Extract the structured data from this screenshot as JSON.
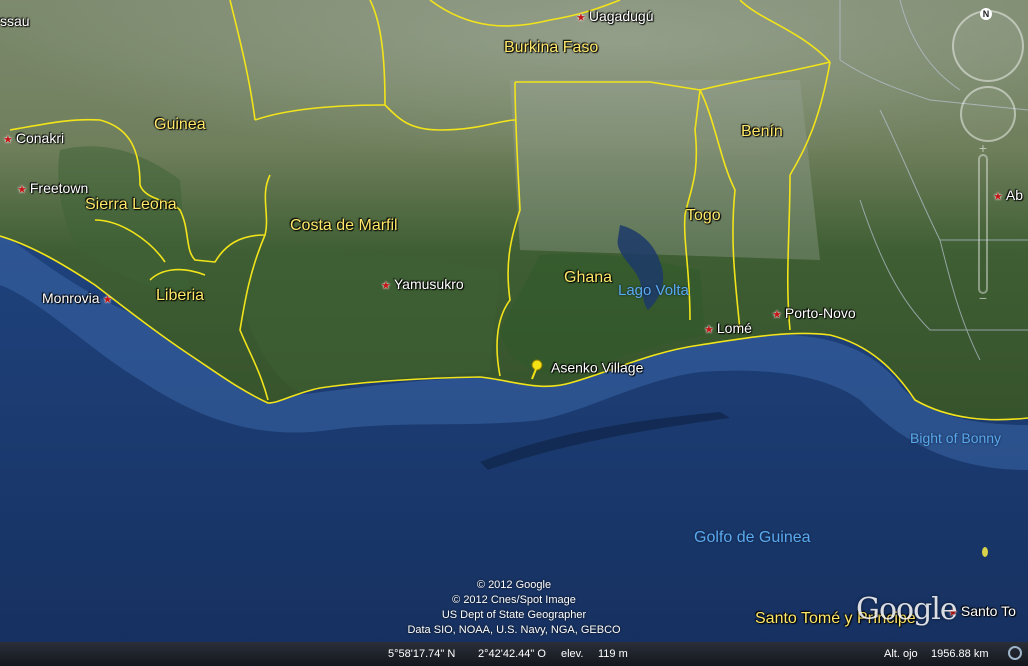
{
  "map": {
    "countries": [
      {
        "label": "Burkina Faso"
      },
      {
        "label": "Guinea"
      },
      {
        "label": "Benín"
      },
      {
        "label": "Sierra Leona"
      },
      {
        "label": "Costa de Marfil"
      },
      {
        "label": "Togo"
      },
      {
        "label": "Ghana"
      },
      {
        "label": "Liberia"
      }
    ],
    "cities": [
      {
        "label": "Uagadugú"
      },
      {
        "label": "Conakri"
      },
      {
        "label": "Freetown"
      },
      {
        "label": "Monrovia"
      },
      {
        "label": "Yamusukro"
      },
      {
        "label": "Lomé"
      },
      {
        "label": "Porto-Novo"
      },
      {
        "label": "Ab"
      },
      {
        "label": "ssau"
      },
      {
        "label": "Santo To"
      }
    ],
    "water": [
      {
        "label": "Lago Volta"
      },
      {
        "label": "Bight of Bonny"
      },
      {
        "label": "Golfo de Guinea"
      },
      {
        "label": "Santo Tomé y Príncipe"
      }
    ],
    "placemark": {
      "label": "Asenko Village",
      "color": "#f5e214"
    }
  },
  "credits": [
    "© 2012 Google",
    "© 2012 Cnes/Spot Image",
    "US Dept of State Geographer",
    "Data SIO, NOAA, U.S. Navy, NGA, GEBCO"
  ],
  "logo": "Google",
  "nav": {
    "north": "N"
  },
  "statusbar": {
    "lat": "5°58'17.74\" N",
    "lon": "2°42'42.44\" O",
    "elev_label": "elev.",
    "elev_value": "119 m",
    "eye_label": "Alt. ojo",
    "eye_value": "1956.88 km"
  },
  "colors": {
    "border": "#f2e41a",
    "ocean": "#1f4684",
    "land": "#4e6a3a",
    "country_label": "#ffe86a",
    "water_label": "#5aa9ee"
  }
}
